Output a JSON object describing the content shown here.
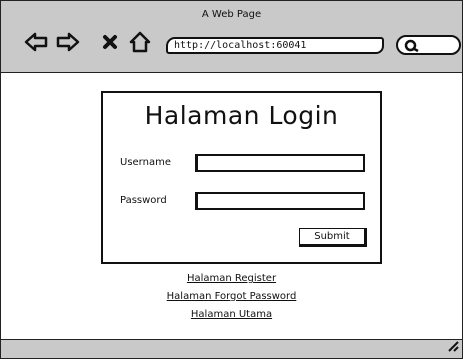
{
  "browser": {
    "page_title": "A Web Page",
    "url": "http://localhost:60041"
  },
  "login": {
    "title": "Halaman Login",
    "username_label": "Username",
    "username_value": "",
    "password_label": "Password",
    "password_value": "",
    "submit_label": "Submit"
  },
  "links": [
    {
      "label": "Halaman Register"
    },
    {
      "label": "Halaman Forgot Password"
    },
    {
      "label": "Halaman Utama"
    }
  ]
}
